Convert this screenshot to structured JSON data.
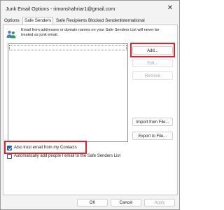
{
  "window": {
    "title": "Junk Email Options - rimonshahriar1@gmail.com"
  },
  "tabs": [
    {
      "label": "Options"
    },
    {
      "label": "Safe Senders"
    },
    {
      "label": "Safe Recipients"
    },
    {
      "label": "Blocked Senders"
    },
    {
      "label": "International"
    }
  ],
  "active_tab": "Safe Senders",
  "description": "Email from addresses or domain names on your Safe Senders List will never be treated as junk email.",
  "buttons": {
    "add": "Add...",
    "edit": "Edit...",
    "remove": "Remove",
    "import": "Import from File...",
    "export": "Export to File..."
  },
  "checkboxes": {
    "trust_contacts": {
      "label": "Also trust email from my Contacts",
      "checked": true
    },
    "auto_add": {
      "label": "Automatically add people I email to the Safe Senders List",
      "checked": false
    }
  },
  "footer": {
    "ok": "OK",
    "cancel": "Cancel",
    "apply": "Apply"
  },
  "colors": {
    "highlight": "#e0242e",
    "check_accent": "#1f5fb8"
  },
  "icons": {
    "people": "people-icon",
    "close": "close-icon"
  }
}
